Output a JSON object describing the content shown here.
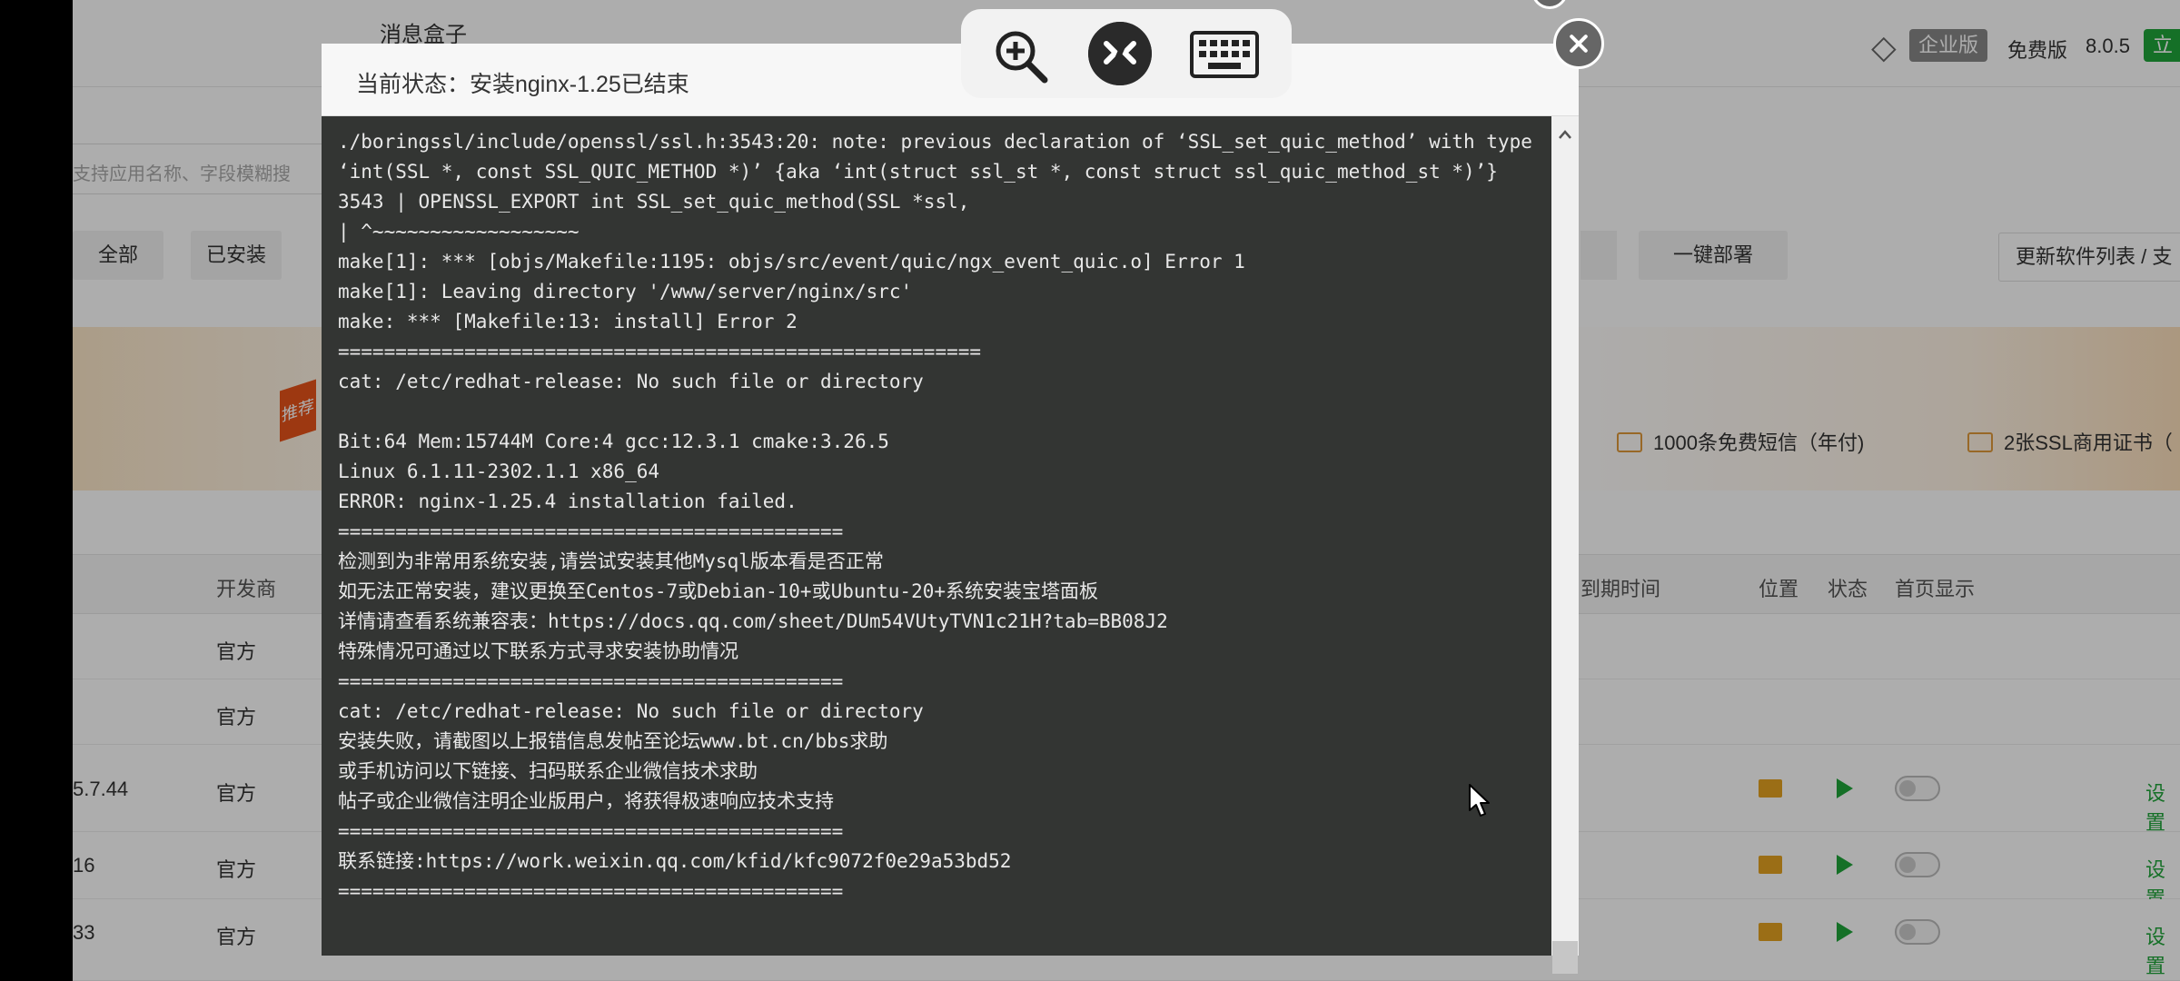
{
  "background": {
    "header_title": "消息盒子",
    "edition_badge": "企业版",
    "free_label": "免费版",
    "version": "8.0.5",
    "update_label": "立",
    "search_placeholder": "支持应用名称、字段模糊搜",
    "tabs": [
      "全部",
      "已安装"
    ],
    "deploy_button": "一键部署",
    "refresh_button": "更新软件列表 / 支",
    "recommend_badge": "推荐",
    "promo_sms": "1000条免费短信（年付)",
    "promo_ssl": "2张SSL商用证书（",
    "table_headers": {
      "developer": "开发商",
      "expire": "到期时间",
      "location": "位置",
      "status": "状态",
      "homepage": "首页显示"
    },
    "rows": [
      {
        "version": "",
        "developer": "官方",
        "has_actions": false
      },
      {
        "version": "",
        "developer": "官方",
        "has_actions": false
      },
      {
        "version": "5.7.44",
        "developer": "官方",
        "has_actions": true,
        "action": "设置"
      },
      {
        "version": "16",
        "developer": "官方",
        "has_actions": true,
        "action": "设置"
      },
      {
        "version": "33",
        "developer": "官方",
        "has_actions": true,
        "action": "设置"
      }
    ]
  },
  "dialog": {
    "title": "当前状态：安装nginx-1.25已结束",
    "log_lines": [
      "./boringssl/include/openssl/ssl.h:3543:20: note: previous declaration of ‘SSL_set_quic_method’ with type ‘int(SSL *, const SSL_QUIC_METHOD *)’ {aka ‘int(struct ssl_st *, const struct ssl_quic_method_st *)’}",
      "3543 | OPENSSL_EXPORT int SSL_set_quic_method(SSL *ssl,",
      "| ^~~~~~~~~~~~~~~~~~~",
      "make[1]: *** [objs/Makefile:1195: objs/src/event/quic/ngx_event_quic.o] Error 1",
      "make[1]: Leaving directory '/www/server/nginx/src'",
      "make: *** [Makefile:13: install] Error 2",
      "========================================================",
      "cat: /etc/redhat-release: No such file or directory",
      "",
      "Bit:64 Mem:15744M Core:4 gcc:12.3.1 cmake:3.26.5",
      "Linux 6.1.11-2302.1.1 x86_64",
      "ERROR: nginx-1.25.4 installation failed.",
      "============================================",
      "检测到为非常用系统安装,请尝试安装其他Mysql版本看是否正常",
      "如无法正常安装，建议更换至Centos-7或Debian-10+或Ubuntu-20+系统安装宝塔面板",
      "详情请查看系统兼容表：https://docs.qq.com/sheet/DUm54VUtyTVN1c21H?tab=BB08J2",
      "特殊情况可通过以下联系方式寻求安装协助情况",
      "============================================",
      "cat: /etc/redhat-release: No such file or directory",
      "安装失败，请截图以上报错信息发帖至论坛www.bt.cn/bbs求助",
      "或手机访问以下链接、扫码联系企业微信技术求助",
      "帖子或企业微信注明企业版用户，将获得极速响应技术支持",
      "============================================",
      "联系链接:https://work.weixin.qq.com/kfid/kfc9072f0e29a53bd52",
      "============================================"
    ]
  },
  "toolbar": {
    "icons": [
      "zoom-in-icon",
      "remote-desktop-icon",
      "keyboard-icon"
    ]
  },
  "colors": {
    "terminal_bg": "#333533",
    "terminal_text": "#e8e8e8",
    "accent_green": "#20a53a",
    "folder_yellow": "#e5a321"
  }
}
